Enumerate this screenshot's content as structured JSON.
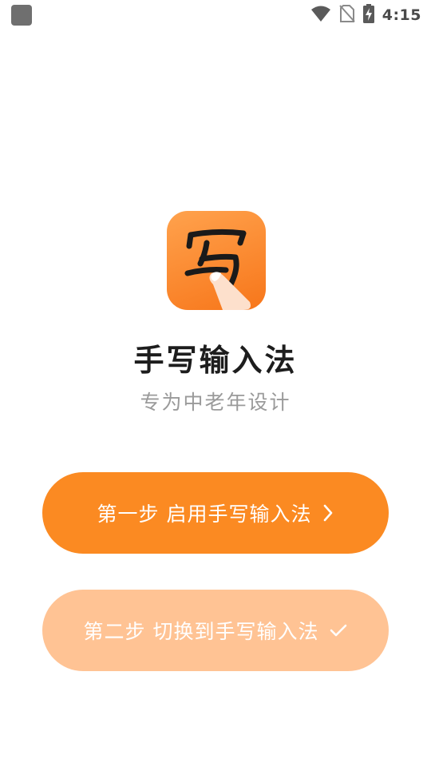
{
  "status_bar": {
    "time": "4:15",
    "icons": [
      "app-notification-icon",
      "wifi-icon",
      "no-sim-icon",
      "battery-charging-icon"
    ]
  },
  "app": {
    "logo_char": "写",
    "title": "手写输入法",
    "subtitle": "专为中老年设计"
  },
  "buttons": {
    "step_one": {
      "label": "第一步 启用手写输入法",
      "icon": "chevron-right-icon"
    },
    "step_two": {
      "label": "第二步 切换到手写输入法",
      "icon": "checkmark-icon"
    }
  },
  "colors": {
    "primary": "#fb8a22",
    "primary_light": "#ffc394",
    "logo_gradient_start": "#ffa24d",
    "logo_gradient_end": "#f7761a",
    "title": "#1d1d1d",
    "subtitle": "#9a9a9a"
  }
}
